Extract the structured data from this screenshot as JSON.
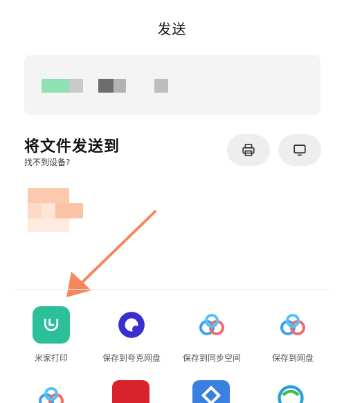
{
  "header": {
    "title": "发送"
  },
  "send_section": {
    "title": "将文件发送到",
    "subtitle": "找不到设备?",
    "print_icon": "printer-icon",
    "screen_icon": "monitor-icon"
  },
  "apps": [
    {
      "label": "米家打印",
      "icon": "mijia-icon",
      "color": "#2bbf9a"
    },
    {
      "label": "保存到夸克网盘",
      "icon": "quark-icon",
      "color": "#3b2ecf"
    },
    {
      "label": "保存到同步空间",
      "icon": "cloud-icon",
      "color": "#3aa0f0"
    },
    {
      "label": "保存到网盘",
      "icon": "cloud-icon",
      "color": "#3aa0f0"
    }
  ],
  "colors": {
    "arrow": "#f5875a",
    "mijia": "#2bbf9a",
    "quark": "#3b2ecf"
  }
}
